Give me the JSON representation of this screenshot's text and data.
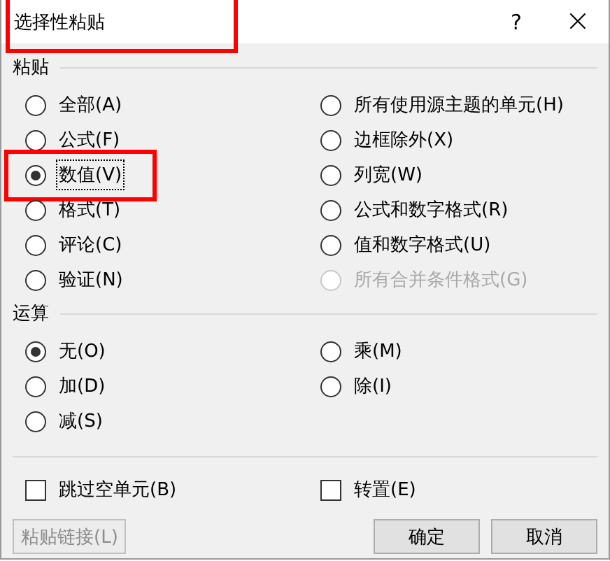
{
  "window": {
    "title": "选择性粘贴",
    "highlight": true,
    "help_button": "?",
    "close_button": "×"
  },
  "paste": {
    "heading": "粘贴",
    "options": [
      {
        "label": "全部(A)",
        "selected": false,
        "disabled": false,
        "highlight": false
      },
      {
        "label": "所有使用源主题的单元(H)",
        "selected": false,
        "disabled": false,
        "highlight": false
      },
      {
        "label": "公式(F)",
        "selected": false,
        "disabled": false,
        "highlight": false
      },
      {
        "label": "边框除外(X)",
        "selected": false,
        "disabled": false,
        "highlight": false
      },
      {
        "label": "数值(V)",
        "selected": true,
        "disabled": false,
        "highlight": true
      },
      {
        "label": "列宽(W)",
        "selected": false,
        "disabled": false,
        "highlight": false
      },
      {
        "label": "格式(T)",
        "selected": false,
        "disabled": false,
        "highlight": false
      },
      {
        "label": "公式和数字格式(R)",
        "selected": false,
        "disabled": false,
        "highlight": false
      },
      {
        "label": "评论(C)",
        "selected": false,
        "disabled": false,
        "highlight": false
      },
      {
        "label": "值和数字格式(U)",
        "selected": false,
        "disabled": false,
        "highlight": false
      },
      {
        "label": "验证(N)",
        "selected": false,
        "disabled": false,
        "highlight": false
      },
      {
        "label": "所有合并条件格式(G)",
        "selected": false,
        "disabled": true,
        "highlight": false
      }
    ]
  },
  "operation": {
    "heading": "运算",
    "options": [
      {
        "label": "无(O)",
        "selected": true
      },
      {
        "label": "乘(M)",
        "selected": false
      },
      {
        "label": "加(D)",
        "selected": false
      },
      {
        "label": "除(I)",
        "selected": false
      },
      {
        "label": "减(S)",
        "selected": false
      }
    ]
  },
  "checkboxes": [
    {
      "label": "跳过空单元(B)",
      "checked": false
    },
    {
      "label": "转置(E)",
      "checked": false
    }
  ],
  "buttons": [
    {
      "label": "粘贴链接(L)",
      "disabled": true
    },
    {
      "label": "确定",
      "disabled": false
    },
    {
      "label": "取消",
      "disabled": false
    }
  ]
}
